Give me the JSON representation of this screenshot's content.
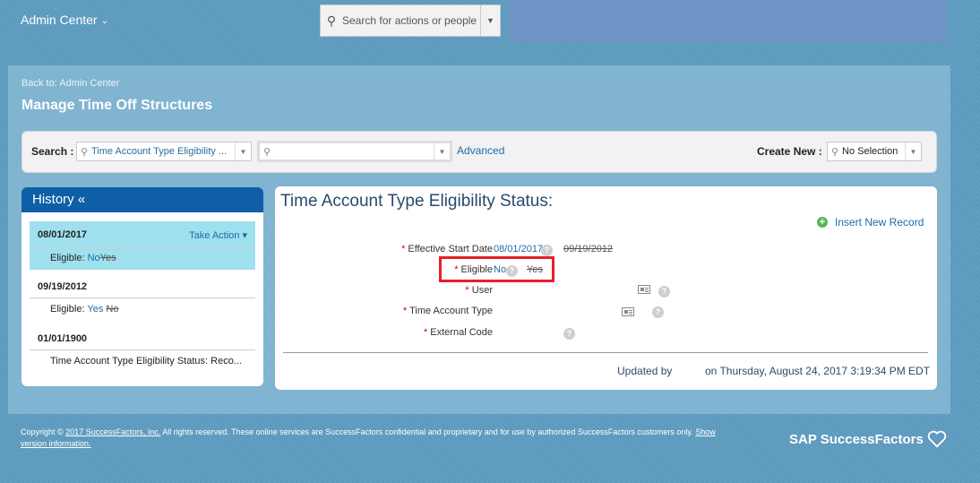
{
  "header": {
    "app_menu": "Admin Center",
    "search_placeholder": "Search for actions or people"
  },
  "page": {
    "back_link": "Back to: Admin Center",
    "title": "Manage Time Off Structures"
  },
  "searchbar": {
    "search_label": "Search :",
    "search_select": "Time Account Type Eligibility ...",
    "search_value": "",
    "advanced": "Advanced",
    "create_new_label": "Create New :",
    "create_new_value": "No Selection"
  },
  "history": {
    "title": "History «",
    "entries": [
      {
        "date": "08/01/2017",
        "action": "Take Action",
        "label": "Eligible:",
        "new": "No",
        "old": "Yes"
      },
      {
        "date": "09/19/2012",
        "label": "Eligible:",
        "new": "Yes",
        "old": "No"
      },
      {
        "date": "01/01/1900",
        "desc": "Time Account Type Eligibility Status: Reco..."
      }
    ]
  },
  "detail": {
    "title": "Time Account Type Eligibility Status:",
    "insert_new": "Insert New Record",
    "required_mark": "*",
    "fields": {
      "effective_start_date": {
        "label": "Effective Start Date",
        "new": "08/01/2017",
        "old": "09/19/2012"
      },
      "eligible": {
        "label": "Eligible",
        "new": "No",
        "old": "Yes"
      },
      "user": {
        "label": "User"
      },
      "time_account_type": {
        "label": "Time Account Type"
      },
      "external_code": {
        "label": "External Code"
      }
    },
    "updated_by": "Updated by",
    "updated_on": "on Thursday, August 24, 2017 3:19:34 PM EDT"
  },
  "footer": {
    "copyright_prefix": "Copyright ©",
    "copyright_link": "2017 SuccessFactors, Inc.",
    "copyright_text": "All rights reserved. These online services are SuccessFactors confidential and proprietary and for use by authorized SuccessFactors customers only.",
    "show_version": "Show version information.",
    "brand": "SAP SuccessFactors"
  },
  "colors": {
    "background": "#5e9cc0",
    "header_block": "#6f93c4",
    "history_header": "#0f5ea8",
    "active_history": "#9fe0ee",
    "link": "#1f6aa8",
    "highlight_box": "#e8202a"
  }
}
